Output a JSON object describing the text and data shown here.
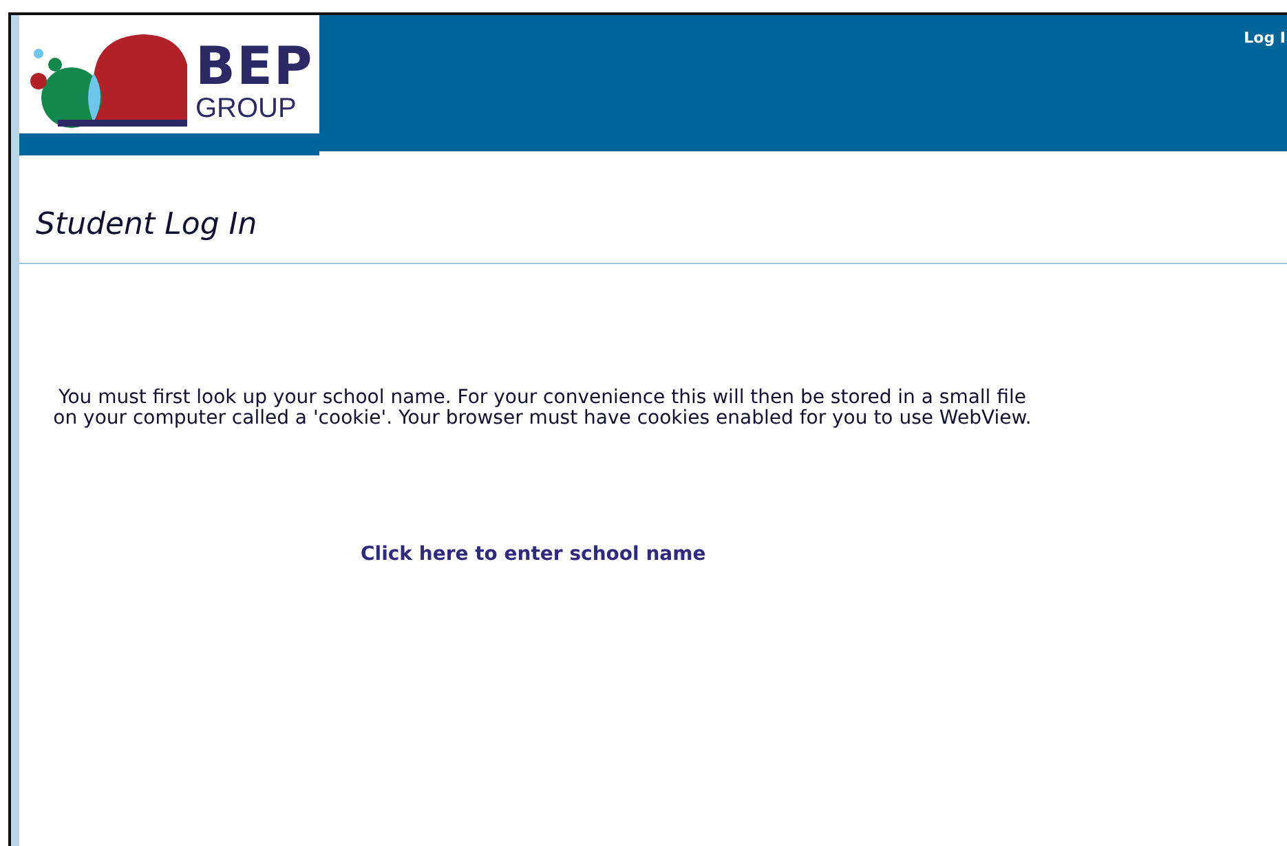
{
  "logo": {
    "name": "BEP",
    "subtitle": "GROUP"
  },
  "header": {
    "login_link": "Log I"
  },
  "page_title": "Student Log In",
  "message": [
    "You must first look up your school name. For your convenience this will then be stored in a small file",
    "on your computer called a 'cookie'. Your browser must have cookies enabled for you to use WebView."
  ],
  "school_link": "Click here to enter school name"
}
